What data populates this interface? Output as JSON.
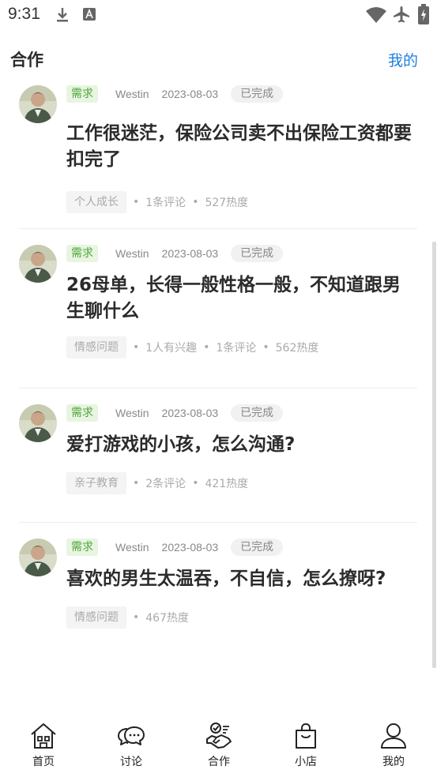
{
  "status_bar": {
    "time": "9:31",
    "icons": [
      "download-icon",
      "keyboard-a-icon",
      "wifi-icon",
      "airplane-icon",
      "battery-charging-icon"
    ]
  },
  "header": {
    "title": "合作",
    "mine_link": "我的"
  },
  "posts": [
    {
      "tag": "需求",
      "author": "Westin",
      "date": "2023-08-03",
      "status": "已完成",
      "title": "工作很迷茫，保险公司卖不出保险工资都要扣完了",
      "topic": "个人成长",
      "stats": [
        "1条评论",
        "527热度"
      ]
    },
    {
      "tag": "需求",
      "author": "Westin",
      "date": "2023-08-03",
      "status": "已完成",
      "title": "26母单，长得一般性格一般，不知道跟男生聊什么",
      "topic": "情感问题",
      "stats": [
        "1人有兴趣",
        "1条评论",
        "562热度"
      ]
    },
    {
      "tag": "需求",
      "author": "Westin",
      "date": "2023-08-03",
      "status": "已完成",
      "title": "爱打游戏的小孩，怎么沟通?",
      "topic": "亲子教育",
      "stats": [
        "2条评论",
        "421热度"
      ]
    },
    {
      "tag": "需求",
      "author": "Westin",
      "date": "2023-08-03",
      "status": "已完成",
      "title": "喜欢的男生太温吞，不自信，怎么撩呀?",
      "topic": "情感问题",
      "stats": [
        "467热度"
      ]
    }
  ],
  "bottom_nav": [
    {
      "label": "首页",
      "icon": "home-icon"
    },
    {
      "label": "讨论",
      "icon": "chat-bubbles-icon"
    },
    {
      "label": "合作",
      "icon": "handshake-icon"
    },
    {
      "label": "小店",
      "icon": "shopping-bag-icon"
    },
    {
      "label": "我的",
      "icon": "user-icon"
    }
  ],
  "colors": {
    "accent_blue": "#1e7fe0",
    "tag_green": "#4fa83a",
    "tag_green_bg": "#e8f5e1"
  }
}
